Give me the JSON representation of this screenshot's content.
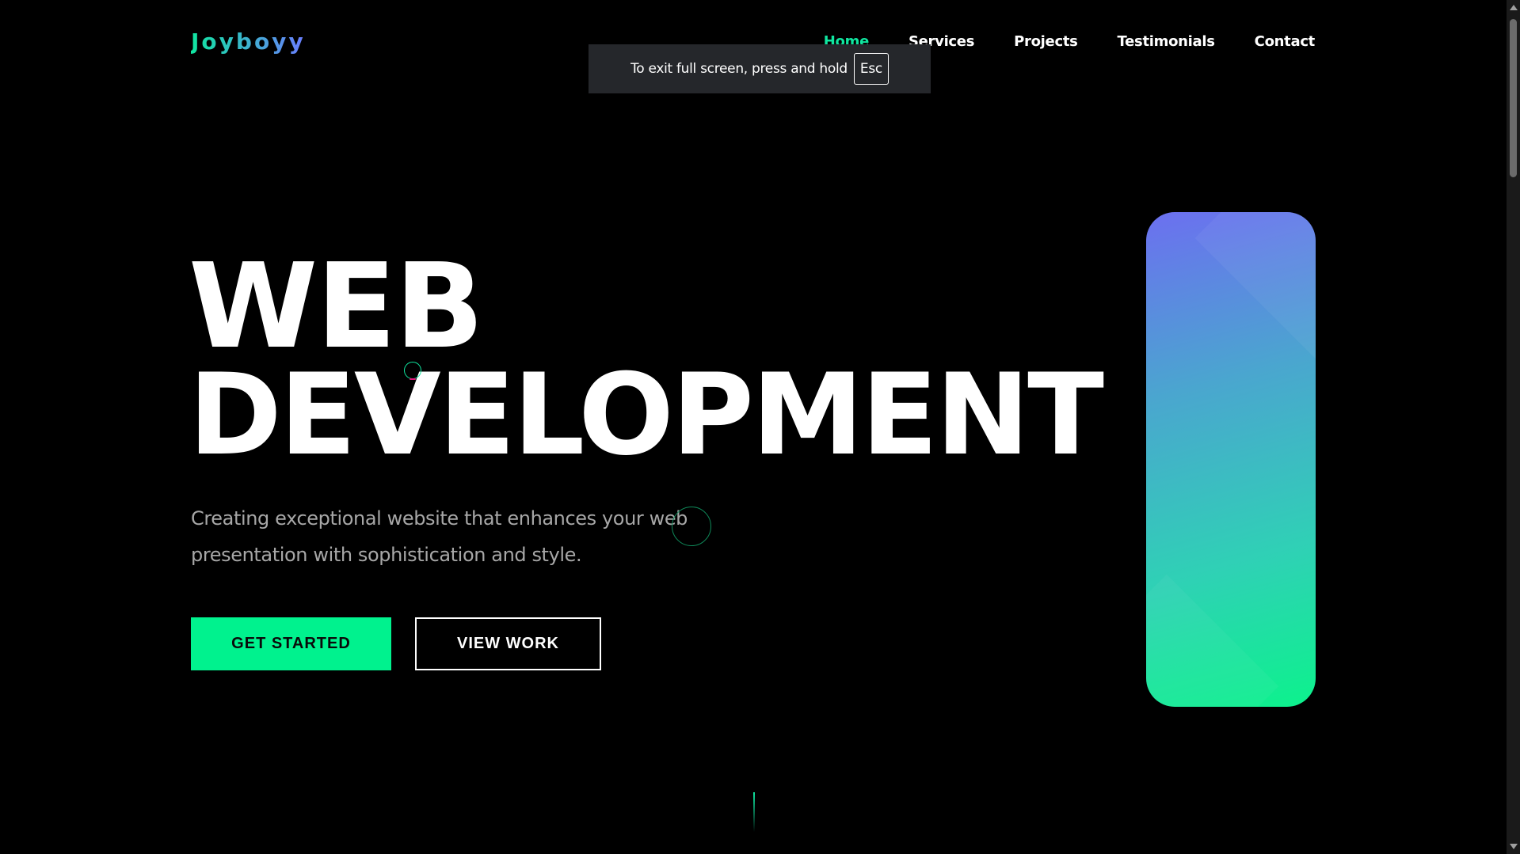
{
  "brand": {
    "logo": "Joyboyy",
    "gradient_start": "#10e6a0",
    "gradient_end": "#6b7cff"
  },
  "nav": {
    "items": [
      {
        "label": "Home",
        "active": true
      },
      {
        "label": "Services",
        "active": false
      },
      {
        "label": "Projects",
        "active": false
      },
      {
        "label": "Testimonials",
        "active": false
      },
      {
        "label": "Contact",
        "active": false
      }
    ]
  },
  "fullscreen_notice": {
    "text": "To exit full screen, press and hold",
    "key": "Esc"
  },
  "hero": {
    "title_line1": "WEB",
    "title_line2": "DEVELOPMENT",
    "subtitle": "Creating exceptional website that enhances your web presentation with sophistication and style.",
    "primary_button": "GET STARTED",
    "secondary_button": "VIEW WORK"
  },
  "colors": {
    "background": "#000000",
    "accent": "#00f28e",
    "text": "#ffffff",
    "muted_text": "#a7a7a7",
    "card_gradient": [
      "#6c6ff0",
      "#4aa6cf",
      "#2fd1b5",
      "#0cf28c"
    ]
  }
}
